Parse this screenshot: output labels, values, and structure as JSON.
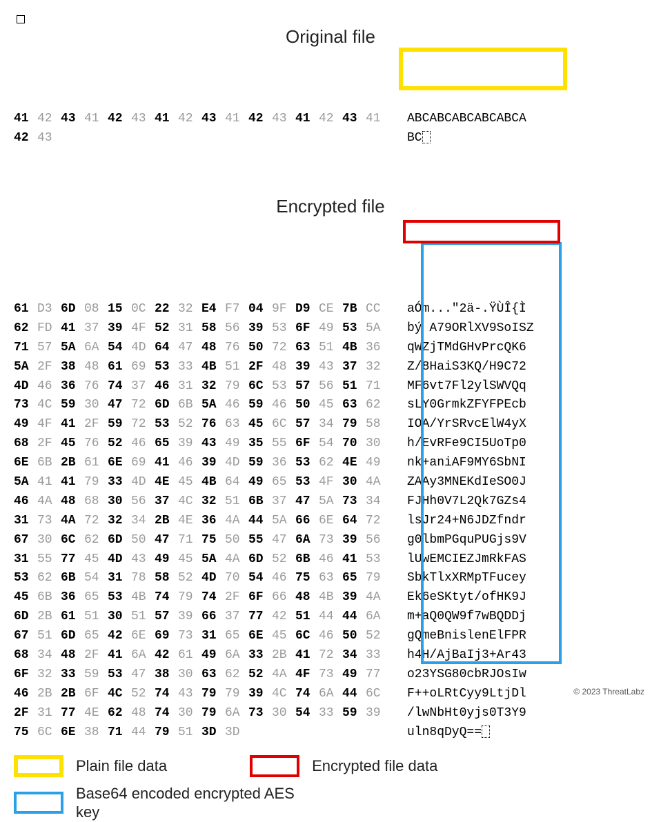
{
  "titles": {
    "original": "Original file",
    "encrypted": "Encrypted file"
  },
  "original": {
    "rows": [
      {
        "hex": [
          "41",
          "42",
          "43",
          "41",
          "42",
          "43",
          "41",
          "42",
          "43",
          "41",
          "42",
          "43",
          "41",
          "42",
          "43",
          "41"
        ],
        "ascii": "ABCABCABCABCABCA"
      },
      {
        "hex": [
          "42",
          "43"
        ],
        "ascii": "BC"
      }
    ]
  },
  "encrypted": {
    "rows": [
      {
        "hex": [
          "61",
          "D3",
          "6D",
          "08",
          "15",
          "0C",
          "22",
          "32",
          "E4",
          "F7",
          "04",
          "9F",
          "D9",
          "CE",
          "7B",
          "CC"
        ],
        "ascii": "aÓm...\"2ä-.ŸÙÎ{Ì"
      },
      {
        "hex": [
          "62",
          "FD",
          "41",
          "37",
          "39",
          "4F",
          "52",
          "31",
          "58",
          "56",
          "39",
          "53",
          "6F",
          "49",
          "53",
          "5A"
        ],
        "ascii": "bý A79ORlXV9SoISZ"
      },
      {
        "hex": [
          "71",
          "57",
          "5A",
          "6A",
          "54",
          "4D",
          "64",
          "47",
          "48",
          "76",
          "50",
          "72",
          "63",
          "51",
          "4B",
          "36"
        ],
        "ascii": "qWZjTMdGHvPrcQK6"
      },
      {
        "hex": [
          "5A",
          "2F",
          "38",
          "48",
          "61",
          "69",
          "53",
          "33",
          "4B",
          "51",
          "2F",
          "48",
          "39",
          "43",
          "37",
          "32"
        ],
        "ascii": "Z/8HaiS3KQ/H9C72"
      },
      {
        "hex": [
          "4D",
          "46",
          "36",
          "76",
          "74",
          "37",
          "46",
          "31",
          "32",
          "79",
          "6C",
          "53",
          "57",
          "56",
          "51",
          "71"
        ],
        "ascii": "MF6vt7Fl2ylSWVQq"
      },
      {
        "hex": [
          "73",
          "4C",
          "59",
          "30",
          "47",
          "72",
          "6D",
          "6B",
          "5A",
          "46",
          "59",
          "46",
          "50",
          "45",
          "63",
          "62"
        ],
        "ascii": "sLY0GrmkZFYFPEcb"
      },
      {
        "hex": [
          "49",
          "4F",
          "41",
          "2F",
          "59",
          "72",
          "53",
          "52",
          "76",
          "63",
          "45",
          "6C",
          "57",
          "34",
          "79",
          "58"
        ],
        "ascii": "IOA/YrSRvcElW4yX"
      },
      {
        "hex": [
          "68",
          "2F",
          "45",
          "76",
          "52",
          "46",
          "65",
          "39",
          "43",
          "49",
          "35",
          "55",
          "6F",
          "54",
          "70",
          "30"
        ],
        "ascii": "h/EvRFe9CI5UoTp0"
      },
      {
        "hex": [
          "6E",
          "6B",
          "2B",
          "61",
          "6E",
          "69",
          "41",
          "46",
          "39",
          "4D",
          "59",
          "36",
          "53",
          "62",
          "4E",
          "49"
        ],
        "ascii": "nk+aniAF9MY6SbNI"
      },
      {
        "hex": [
          "5A",
          "41",
          "41",
          "79",
          "33",
          "4D",
          "4E",
          "45",
          "4B",
          "64",
          "49",
          "65",
          "53",
          "4F",
          "30",
          "4A"
        ],
        "ascii": "ZAAy3MNEKdIeSO0J"
      },
      {
        "hex": [
          "46",
          "4A",
          "48",
          "68",
          "30",
          "56",
          "37",
          "4C",
          "32",
          "51",
          "6B",
          "37",
          "47",
          "5A",
          "73",
          "34"
        ],
        "ascii": "FJHh0V7L2Qk7GZs4"
      },
      {
        "hex": [
          "31",
          "73",
          "4A",
          "72",
          "32",
          "34",
          "2B",
          "4E",
          "36",
          "4A",
          "44",
          "5A",
          "66",
          "6E",
          "64",
          "72"
        ],
        "ascii": "lsJr24+N6JDZfndr"
      },
      {
        "hex": [
          "67",
          "30",
          "6C",
          "62",
          "6D",
          "50",
          "47",
          "71",
          "75",
          "50",
          "55",
          "47",
          "6A",
          "73",
          "39",
          "56"
        ],
        "ascii": "g0lbmPGquPUGjs9V"
      },
      {
        "hex": [
          "31",
          "55",
          "77",
          "45",
          "4D",
          "43",
          "49",
          "45",
          "5A",
          "4A",
          "6D",
          "52",
          "6B",
          "46",
          "41",
          "53"
        ],
        "ascii": "lUwEMCIEZJmRkFAS"
      },
      {
        "hex": [
          "53",
          "62",
          "6B",
          "54",
          "31",
          "78",
          "58",
          "52",
          "4D",
          "70",
          "54",
          "46",
          "75",
          "63",
          "65",
          "79"
        ],
        "ascii": "SbkTlxXRMpTFucey"
      },
      {
        "hex": [
          "45",
          "6B",
          "36",
          "65",
          "53",
          "4B",
          "74",
          "79",
          "74",
          "2F",
          "6F",
          "66",
          "48",
          "4B",
          "39",
          "4A"
        ],
        "ascii": "Ek6eSKtyt/ofHK9J"
      },
      {
        "hex": [
          "6D",
          "2B",
          "61",
          "51",
          "30",
          "51",
          "57",
          "39",
          "66",
          "37",
          "77",
          "42",
          "51",
          "44",
          "44",
          "6A"
        ],
        "ascii": "m+aQ0QW9f7wBQDDj"
      },
      {
        "hex": [
          "67",
          "51",
          "6D",
          "65",
          "42",
          "6E",
          "69",
          "73",
          "31",
          "65",
          "6E",
          "45",
          "6C",
          "46",
          "50",
          "52"
        ],
        "ascii": "gQmeBnislenElFPR"
      },
      {
        "hex": [
          "68",
          "34",
          "48",
          "2F",
          "41",
          "6A",
          "42",
          "61",
          "49",
          "6A",
          "33",
          "2B",
          "41",
          "72",
          "34",
          "33"
        ],
        "ascii": "h4H/AjBaIj3+Ar43"
      },
      {
        "hex": [
          "6F",
          "32",
          "33",
          "59",
          "53",
          "47",
          "38",
          "30",
          "63",
          "62",
          "52",
          "4A",
          "4F",
          "73",
          "49",
          "77"
        ],
        "ascii": "o23YSG80cbRJOsIw"
      },
      {
        "hex": [
          "46",
          "2B",
          "2B",
          "6F",
          "4C",
          "52",
          "74",
          "43",
          "79",
          "79",
          "39",
          "4C",
          "74",
          "6A",
          "44",
          "6C"
        ],
        "ascii": "F++oLRtCyy9LtjDl"
      },
      {
        "hex": [
          "2F",
          "31",
          "77",
          "4E",
          "62",
          "48",
          "74",
          "30",
          "79",
          "6A",
          "73",
          "30",
          "54",
          "33",
          "59",
          "39"
        ],
        "ascii": "/lwNbHt0yjs0T3Y9"
      },
      {
        "hex": [
          "75",
          "6C",
          "6E",
          "38",
          "71",
          "44",
          "79",
          "51",
          "3D",
          "3D"
        ],
        "ascii": "uln8qDyQ=="
      }
    ]
  },
  "legend": {
    "plain": "Plain file data",
    "encrypted": "Encrypted file data",
    "aes": "Base64 encoded encrypted AES key"
  },
  "copyright": "© 2023 ThreatLabz",
  "colors": {
    "yellow": "#ffe100",
    "red": "#e00000",
    "blue": "#2aa0e8"
  }
}
